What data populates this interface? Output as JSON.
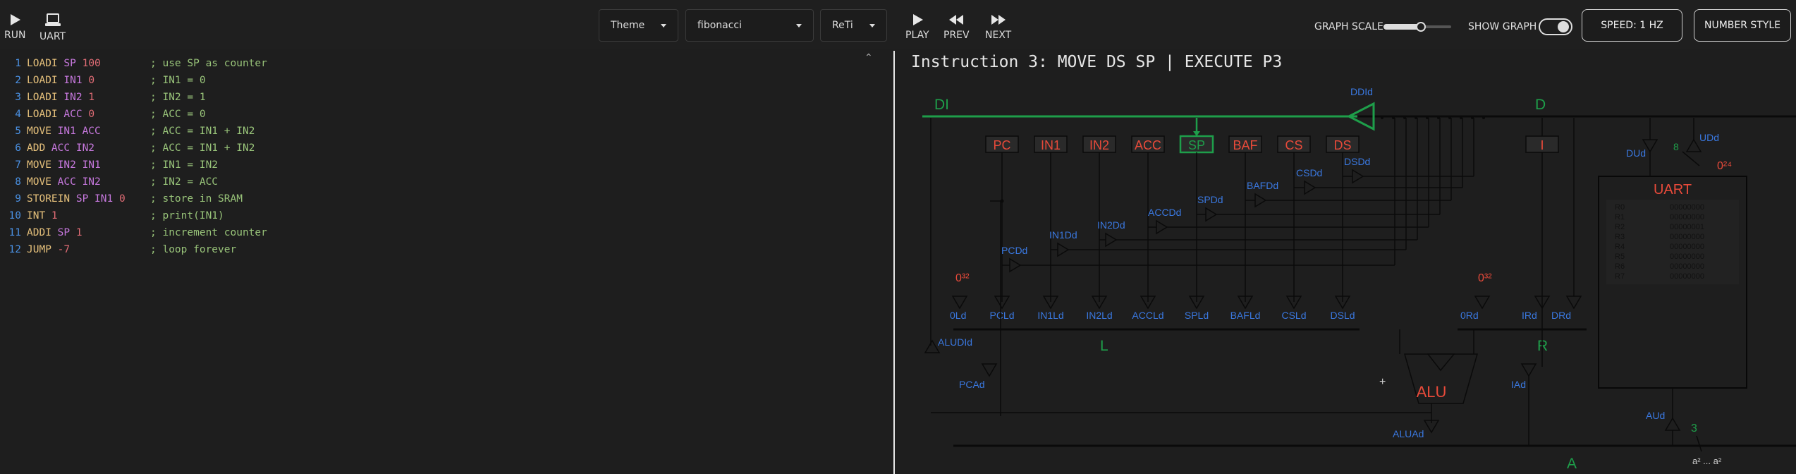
{
  "toolbar": {
    "run_label": "RUN",
    "uart_label": "UART",
    "theme_label": "Theme",
    "program_value": "fibonacci",
    "arch_value": "ReTi",
    "play_label": "PLAY",
    "prev_label": "PREV",
    "next_label": "NEXT",
    "graph_scale_label": "GRAPH SCALE",
    "graph_scale_level": 0.55,
    "show_graph_label": "SHOW GRAPH",
    "show_graph_on": true,
    "speed_label": "SPEED: 1 HZ",
    "number_style_label": "NUMBER STYLE"
  },
  "colors": {
    "background": "#1e1e1e",
    "line_number": "#4a90e2",
    "mnemonic": "#e5c07b",
    "register": "#c678dd",
    "immediate": "#e06c75",
    "comment": "#98c379",
    "bus_green": "#1e9e4a",
    "register_red": "#e84a3a",
    "signal_blue": "#3a78e0"
  },
  "editor": {
    "lines": [
      {
        "n": "1",
        "tokens": [
          {
            "t": "LOADI ",
            "c": "mnemonic"
          },
          {
            "t": "SP ",
            "c": "register"
          },
          {
            "t": "100",
            "c": "immediate"
          }
        ],
        "comment": "; use SP as counter"
      },
      {
        "n": "2",
        "tokens": [
          {
            "t": "LOADI ",
            "c": "mnemonic"
          },
          {
            "t": "IN1 ",
            "c": "register"
          },
          {
            "t": "0",
            "c": "immediate"
          }
        ],
        "comment": "; IN1 = 0"
      },
      {
        "n": "3",
        "tokens": [
          {
            "t": "LOADI ",
            "c": "mnemonic"
          },
          {
            "t": "IN2 ",
            "c": "register"
          },
          {
            "t": "1",
            "c": "immediate"
          }
        ],
        "comment": "; IN2 = 1"
      },
      {
        "n": "4",
        "tokens": [
          {
            "t": "LOADI ",
            "c": "mnemonic"
          },
          {
            "t": "ACC ",
            "c": "register"
          },
          {
            "t": "0",
            "c": "immediate"
          }
        ],
        "comment": "; ACC = 0"
      },
      {
        "n": "5",
        "tokens": [
          {
            "t": "MOVE ",
            "c": "mnemonic"
          },
          {
            "t": "IN1 ",
            "c": "register"
          },
          {
            "t": "ACC",
            "c": "register"
          }
        ],
        "comment": "; ACC = IN1 + IN2"
      },
      {
        "n": "6",
        "tokens": [
          {
            "t": "ADD ",
            "c": "mnemonic"
          },
          {
            "t": "ACC ",
            "c": "register"
          },
          {
            "t": "IN2",
            "c": "register"
          }
        ],
        "comment": "; ACC = IN1 + IN2"
      },
      {
        "n": "7",
        "tokens": [
          {
            "t": "MOVE ",
            "c": "mnemonic"
          },
          {
            "t": "IN2 ",
            "c": "register"
          },
          {
            "t": "IN1",
            "c": "register"
          }
        ],
        "comment": "; IN1 = IN2"
      },
      {
        "n": "8",
        "tokens": [
          {
            "t": "MOVE ",
            "c": "mnemonic"
          },
          {
            "t": "ACC ",
            "c": "register"
          },
          {
            "t": "IN2",
            "c": "register"
          }
        ],
        "comment": "; IN2 = ACC"
      },
      {
        "n": "9",
        "tokens": [
          {
            "t": "STOREIN ",
            "c": "mnemonic"
          },
          {
            "t": "SP ",
            "c": "register"
          },
          {
            "t": "IN1 ",
            "c": "register"
          },
          {
            "t": "0",
            "c": "immediate"
          }
        ],
        "comment": "; store in SRAM"
      },
      {
        "n": "10",
        "tokens": [
          {
            "t": "INT ",
            "c": "mnemonic"
          },
          {
            "t": "1",
            "c": "immediate"
          }
        ],
        "comment": "; print(IN1)"
      },
      {
        "n": "11",
        "tokens": [
          {
            "t": "ADDI ",
            "c": "mnemonic"
          },
          {
            "t": "SP ",
            "c": "register"
          },
          {
            "t": "1",
            "c": "immediate"
          }
        ],
        "comment": "; increment counter"
      },
      {
        "n": "12",
        "tokens": [
          {
            "t": "JUMP ",
            "c": "mnemonic"
          },
          {
            "t": "-7",
            "c": "immediate"
          }
        ],
        "comment": "; loop forever"
      }
    ]
  },
  "simulator": {
    "title": "Instruction 3: MOVE DS SP | EXECUTE P3",
    "bus_labels": {
      "di": "DI",
      "d": "D",
      "l": "L",
      "r": "R",
      "a": "A"
    },
    "registers": [
      "PC",
      "IN1",
      "IN2",
      "ACC",
      "SP",
      "BAF",
      "CS",
      "DS"
    ],
    "active_register": "SP",
    "i_register": "I",
    "driver_labels": [
      "PCDd",
      "IN1Dd",
      "IN2Dd",
      "ACCDd",
      "SPDd",
      "BAFDd",
      "CSDd",
      "DSDd"
    ],
    "load_labels": [
      "PCLd",
      "IN1Ld",
      "IN2Ld",
      "ACCLd",
      "SPLd",
      "BAFLd",
      "CSLd",
      "DSLd"
    ],
    "signals": {
      "ddid": "DDId",
      "zero_ld": "0Ld",
      "zero32_left": "0³²",
      "zero32_right": "0³²",
      "aludld": "ALUDId",
      "pcad": "PCAd",
      "aluad": "ALUAd",
      "zero_rd": "0Rd",
      "ird": "IRd",
      "drd": "DRd",
      "iad": "IAd",
      "dud": "DUd",
      "udd": "UDd",
      "eight": "8",
      "zero24": "0²⁴",
      "aud": "AUd",
      "three": "3",
      "a_bits": "a² ... a²"
    },
    "alu_label": "ALU",
    "alu_plus": "+",
    "uart": {
      "title": "UART",
      "regs": [
        {
          "name": "R0",
          "value": "00000000"
        },
        {
          "name": "R1",
          "value": "00000000"
        },
        {
          "name": "R2",
          "value": "00000001"
        },
        {
          "name": "R3",
          "value": "00000000"
        },
        {
          "name": "R4",
          "value": "00000000"
        },
        {
          "name": "R5",
          "value": "00000000"
        },
        {
          "name": "R6",
          "value": "00000000"
        },
        {
          "name": "R7",
          "value": "00000000"
        }
      ]
    }
  }
}
